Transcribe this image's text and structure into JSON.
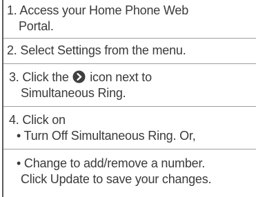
{
  "instructions": {
    "step1": {
      "line1": "1. Access your Home Phone Web",
      "line2": "Portal."
    },
    "step2": {
      "line1": "2. Select Settings from the menu."
    },
    "step3": {
      "before_icon": "3. Click the ",
      "after_icon": " icon next to",
      "line2": "Simultaneous Ring.",
      "icon": "chevron-right-circle-icon"
    },
    "step4": {
      "line1": "4. Click on",
      "bullet1": "• Turn Off Simultaneous Ring. Or,",
      "bullet2_line1": "• Change to add/remove a number.",
      "bullet2_line2": "Click Update to save your changes."
    }
  },
  "colors": {
    "text": "#3a3a3a",
    "rule": "#5a5a5a",
    "divider": "#9e9e9e",
    "icon": "#3f3f3f"
  }
}
